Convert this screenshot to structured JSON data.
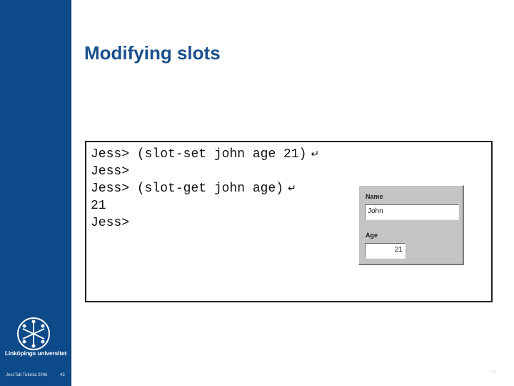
{
  "slide": {
    "title": "Modifying slots",
    "footer_left": "JessTab Tutorial 2006",
    "footer_number": "43",
    "footer_right": "43"
  },
  "sidebar": {
    "logo_icon": "university-logo-icon",
    "logo_caption": "Linköpings universitet",
    "background": "#0d4a8a"
  },
  "console": {
    "lines": [
      {
        "prompt": "Jess>",
        "command": "(slot-set john age 21)",
        "enter_icon": "↵"
      },
      {
        "prompt": "Jess>",
        "command": "",
        "enter_icon": ""
      },
      {
        "prompt": "Jess>",
        "command": "(slot-get john age)",
        "enter_icon": "↵"
      },
      {
        "prompt": "21",
        "command": "",
        "enter_icon": ""
      },
      {
        "prompt": "Jess>",
        "command": "",
        "enter_icon": ""
      }
    ]
  },
  "form_panel": {
    "name_label": "Name",
    "name_value": "John",
    "age_label": "Age",
    "age_value": "21"
  },
  "colors": {
    "title": "#1a4f8b",
    "sidebar": "#0d4a8a",
    "panel": "#c4c4c4"
  }
}
